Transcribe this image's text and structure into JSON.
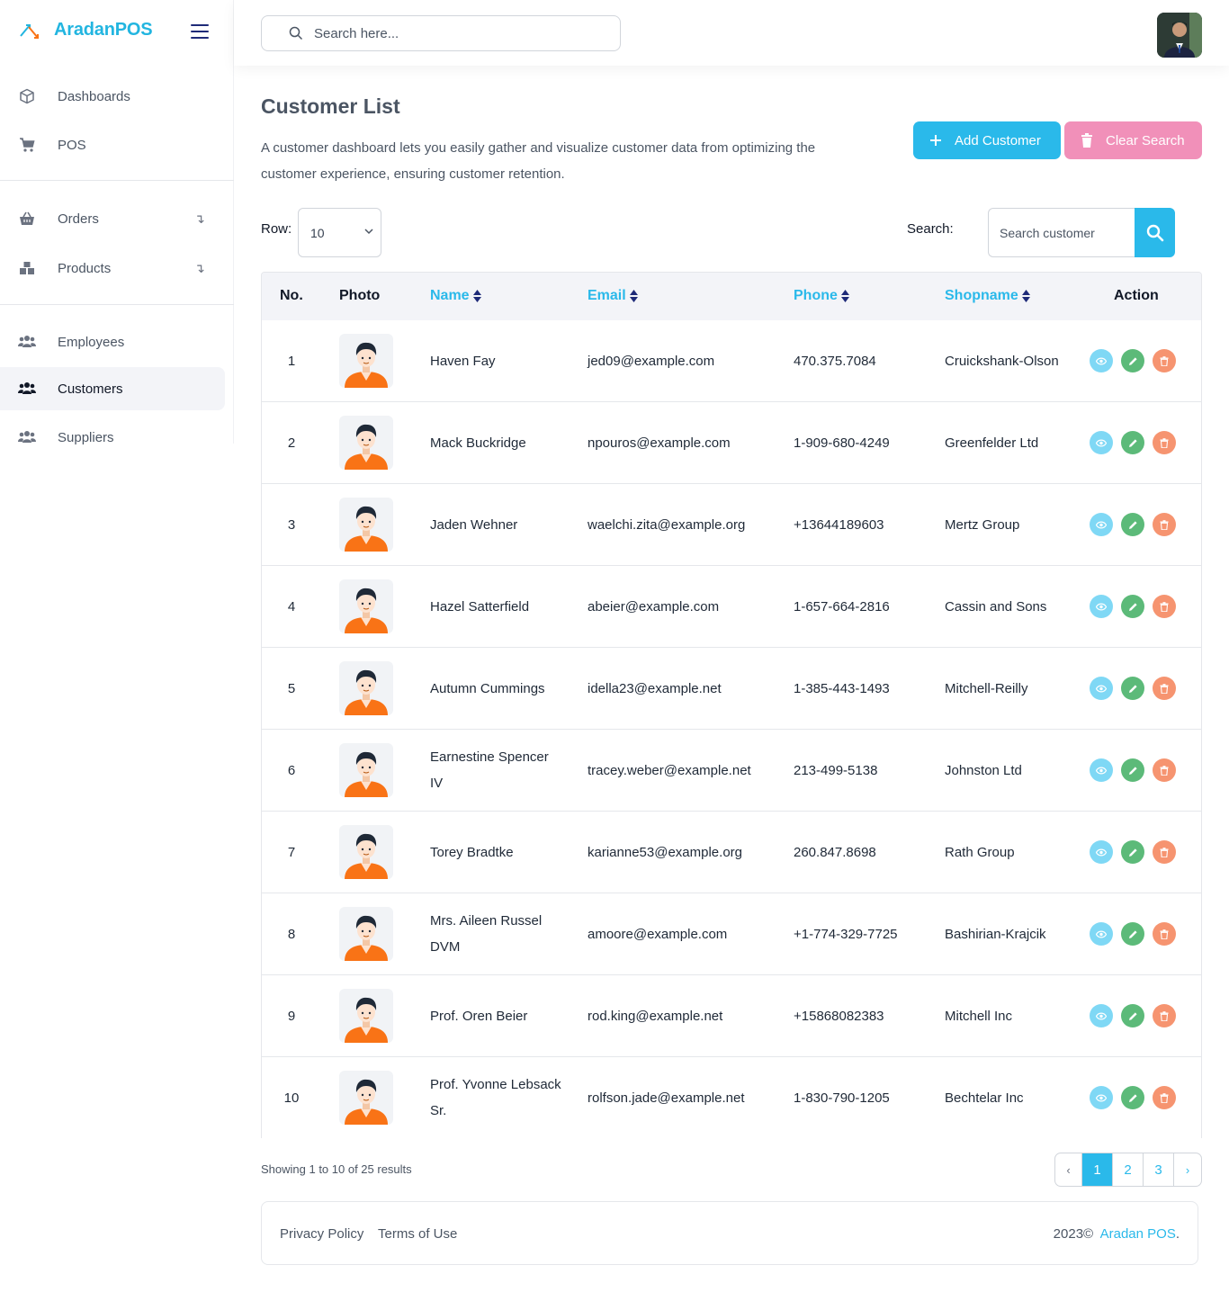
{
  "brand": {
    "name": "AradanPOS"
  },
  "sidebar": {
    "items": [
      {
        "label": "Dashboards",
        "icon": "cube-icon"
      },
      {
        "label": "POS",
        "icon": "cart-icon"
      },
      {
        "label": "Orders",
        "icon": "basket-icon",
        "caret": "↴"
      },
      {
        "label": "Products",
        "icon": "boxes-icon",
        "caret": "↴"
      },
      {
        "label": "Employees",
        "icon": "users-icon"
      },
      {
        "label": "Customers",
        "icon": "users-icon",
        "active": true
      },
      {
        "label": "Suppliers",
        "icon": "users-icon"
      }
    ]
  },
  "topbar": {
    "search_placeholder": "Search here..."
  },
  "page": {
    "title": "Customer List",
    "description": "A customer dashboard lets you easily gather and visualize customer data from optimizing the customer experience, ensuring customer retention.",
    "add_label": "Add Customer",
    "clear_label": "Clear Search"
  },
  "controls": {
    "row_label": "Row:",
    "row_value": "10",
    "search_label": "Search:",
    "search_placeholder": "Search customer"
  },
  "table": {
    "headers": {
      "no": "No.",
      "photo": "Photo",
      "name": "Name",
      "email": "Email",
      "phone": "Phone",
      "shop": "Shopname",
      "action": "Action"
    },
    "rows": [
      {
        "no": "1",
        "name": "Haven Fay",
        "email": "jed09@example.com",
        "phone": "470.375.7084",
        "shop": "Cruickshank-Olson"
      },
      {
        "no": "2",
        "name": "Mack Buckridge",
        "email": "npouros@example.com",
        "phone": "1-909-680-4249",
        "shop": "Greenfelder Ltd"
      },
      {
        "no": "3",
        "name": "Jaden Wehner",
        "email": "waelchi.zita@example.org",
        "phone": "+13644189603",
        "shop": "Mertz Group"
      },
      {
        "no": "4",
        "name": "Hazel Satterfield",
        "email": "abeier@example.com",
        "phone": "1-657-664-2816",
        "shop": "Cassin and Sons"
      },
      {
        "no": "5",
        "name": "Autumn Cummings",
        "email": "idella23@example.net",
        "phone": "1-385-443-1493",
        "shop": "Mitchell-Reilly"
      },
      {
        "no": "6",
        "name": "Earnestine Spencer IV",
        "email": "tracey.weber@example.net",
        "phone": "213-499-5138",
        "shop": "Johnston Ltd"
      },
      {
        "no": "7",
        "name": "Torey Bradtke",
        "email": "karianne53@example.org",
        "phone": "260.847.8698",
        "shop": "Rath Group"
      },
      {
        "no": "8",
        "name": "Mrs. Aileen Russel DVM",
        "email": "amoore@example.com",
        "phone": "+1-774-329-7725",
        "shop": "Bashirian-Krajcik"
      },
      {
        "no": "9",
        "name": "Prof. Oren Beier",
        "email": "rod.king@example.net",
        "phone": "+15868082383",
        "shop": "Mitchell Inc"
      },
      {
        "no": "10",
        "name": "Prof. Yvonne Lebsack Sr.",
        "email": "rolfson.jade@example.net",
        "phone": "1-830-790-1205",
        "shop": "Bechtelar Inc"
      }
    ]
  },
  "pagination": {
    "showing": "Showing 1 to 10 of 25 results",
    "prev": "‹",
    "next": "›",
    "pages": [
      "1",
      "2",
      "3"
    ],
    "current": "1"
  },
  "footer": {
    "privacy": "Privacy Policy",
    "terms": "Terms of Use",
    "copyright": "2023©",
    "brand": "Aradan POS",
    "period": "."
  },
  "colors": {
    "accent": "#2ab9ea",
    "clear_button": "#f190b9",
    "view": "#7fd8f5",
    "edit": "#5cba79",
    "delete": "#f69470"
  }
}
